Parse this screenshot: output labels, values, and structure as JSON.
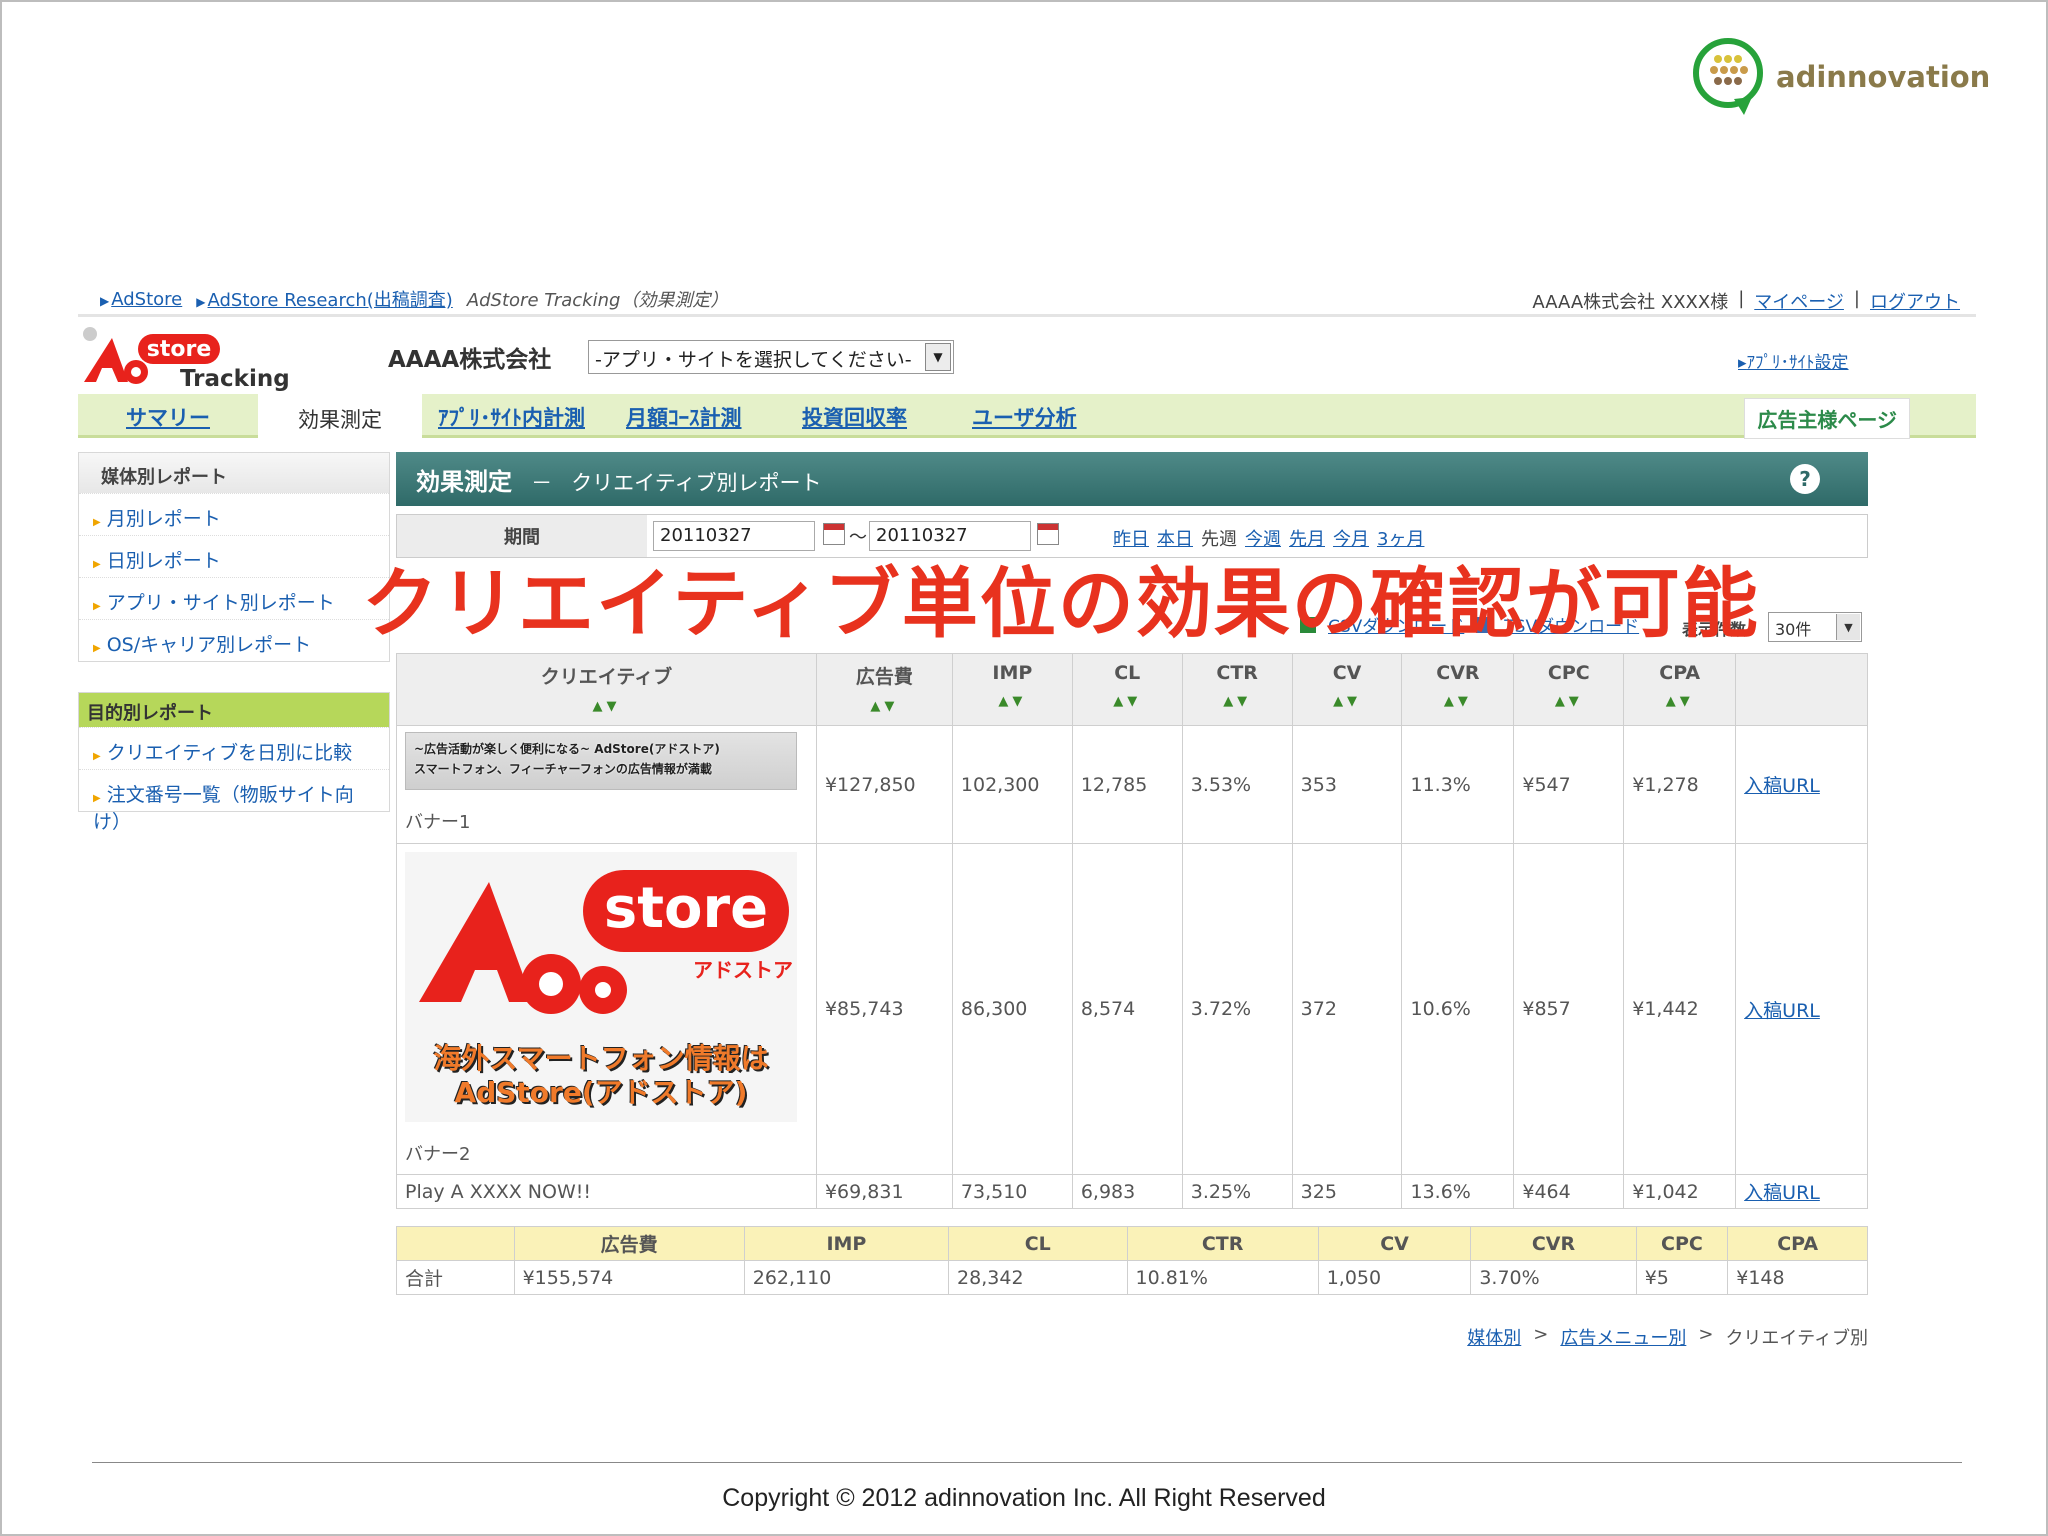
{
  "brand": {
    "name": "adinnovation",
    "colors": {
      "green": "#27a23a",
      "olive": "#8a7a4a",
      "red": "#e8321e"
    }
  },
  "top_links": {
    "crumbs": [
      "AdStore",
      "AdStore Research(出稿調査)"
    ],
    "current": "AdStore Tracking（効果測定）",
    "user": "AAAA株式会社 XXXX様",
    "sep": "|",
    "mypage": "マイページ",
    "logout": "ログアウト"
  },
  "app": {
    "logo_store": "store",
    "logo_tracking": "Tracking",
    "company": "AAAA株式会社",
    "site_select": "-アプリ・サイトを選択してください-",
    "settings_link": "ｱﾌﾟﾘ･ｻｲﾄ設定"
  },
  "nav": {
    "items": [
      "サマリー",
      "効果測定",
      "ｱﾌﾟﾘ･ｻｲﾄ内計測",
      "月額ｺｰｽ計測",
      "投資回収率",
      "ユーザ分析"
    ],
    "active_index": 1,
    "advertiser": "広告主様ページ"
  },
  "sidebar": {
    "media_head": "媒体別レポート",
    "media_items": [
      "月別レポート",
      "日別レポート",
      "アプリ・サイト別レポート",
      "OS/キャリア別レポート"
    ],
    "purpose_head": "目的別レポート",
    "purpose_items": [
      "クリエイティブを日別に比較",
      "注文番号一覧（物販サイト向け）"
    ]
  },
  "panel": {
    "title": "効果測定",
    "dash": "－",
    "subtitle": "クリエイティブ別レポート",
    "help": "?"
  },
  "period": {
    "label": "期間",
    "from": "20110327",
    "tilde": "～",
    "to": "20110327",
    "quick": [
      "昨日",
      "本日",
      "先週",
      "今週",
      "先月",
      "今月",
      "3ヶ月"
    ]
  },
  "downloads": {
    "csv": "CSVダウンロード",
    "tsv": "TSVダウンロード",
    "count_label": "表示件数：",
    "count_value": "30件"
  },
  "headline": "クリエイティブ単位の効果の確認が可能",
  "table": {
    "headers": [
      "クリエイティブ",
      "広告費",
      "IMP",
      "CL",
      "CTR",
      "CV",
      "CVR",
      "CPC",
      "CPA"
    ],
    "sort_glyph": "▲▼",
    "rows": [
      {
        "creative_lines": [
          "~広告活動が楽しく便利になる~ AdStore(アドストア)",
          "スマートフォン、フィーチャーフォンの広告情報が満載"
        ],
        "caption": "バナー1",
        "cost": "¥127,850",
        "imp": "102,300",
        "cl": "12,785",
        "ctr": "3.53%",
        "cv": "353",
        "cvr": "11.3%",
        "cpc": "¥547",
        "cpa": "¥1,278",
        "link": "入稿URL"
      },
      {
        "banner_store": "store",
        "banner_sub": "アドストア",
        "banner_msg": [
          "海外スマートフォン情報は",
          "AdStore(アドストア)"
        ],
        "caption": "バナー2",
        "cost": "¥85,743",
        "imp": "86,300",
        "cl": "8,574",
        "ctr": "3.72%",
        "cv": "372",
        "cvr": "10.6%",
        "cpc": "¥857",
        "cpa": "¥1,442",
        "link": "入稿URL"
      },
      {
        "caption": "Play A XXXX NOW!!",
        "cost": "¥69,831",
        "imp": "73,510",
        "cl": "6,983",
        "ctr": "3.25%",
        "cv": "325",
        "cvr": "13.6%",
        "cpc": "¥464",
        "cpa": "¥1,042",
        "link": "入稿URL"
      }
    ]
  },
  "total": {
    "headers": [
      "",
      "広告費",
      "IMP",
      "CL",
      "CTR",
      "CV",
      "CVR",
      "CPC",
      "CPA"
    ],
    "row": [
      "合計",
      "¥155,574",
      "262,110",
      "28,342",
      "10.81%",
      "1,050",
      "3.70%",
      "¥5",
      "¥148"
    ]
  },
  "crumb_bottom": {
    "items": [
      "媒体別",
      "広告メニュー別"
    ],
    "sep": ">",
    "current": "クリエイティブ別"
  },
  "copyright": "Copyright © 2012 adinnovation Inc. All Right Reserved"
}
